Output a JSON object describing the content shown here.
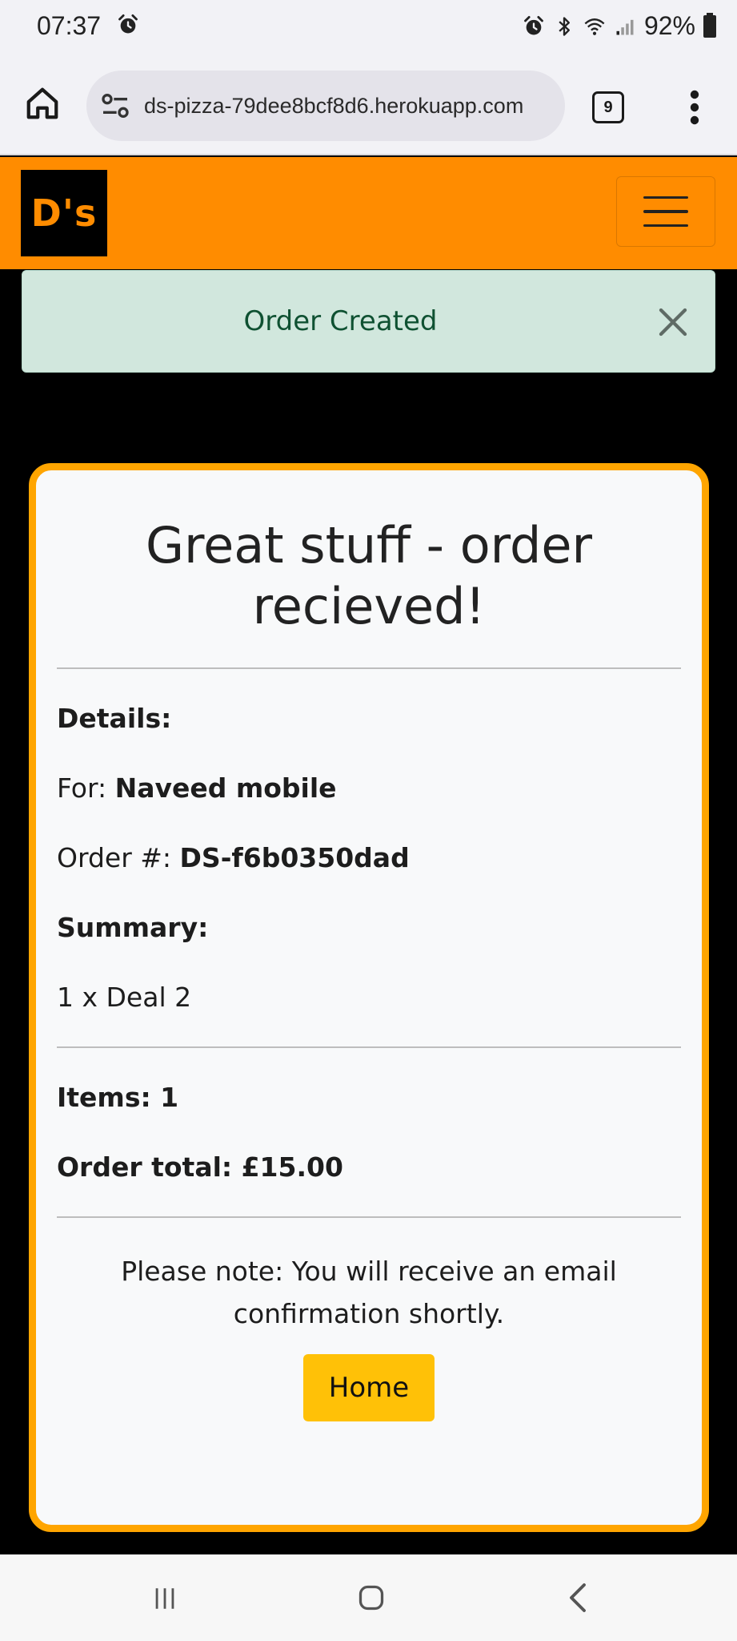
{
  "status_bar": {
    "time": "07:37",
    "battery": "92%",
    "icons": [
      "alarm-icon",
      "alarm-icon",
      "bluetooth-icon",
      "wifi-icon",
      "signal-icon",
      "battery-icon"
    ]
  },
  "browser": {
    "url": "ds-pizza-79dee8bcf8d6.herokuapp.com",
    "tab_count": "9"
  },
  "header": {
    "brand": "D's",
    "brand_color": "#ff8c00"
  },
  "alert": {
    "message": "Order Created"
  },
  "card": {
    "title": "Great stuff - order recieved!",
    "details_label": "Details:",
    "for_label": "For: ",
    "for_value": "Naveed mobile",
    "order_label": "Order #: ",
    "order_value": "DS-f6b0350dad",
    "summary_label": "Summary:",
    "summary_items": [
      "1 x Deal 2"
    ],
    "items_text": "Items: 1",
    "total_text": "Order total: £15.00",
    "note": "Please note: You will receive an email confirmation shortly.",
    "home_button": "Home"
  },
  "colors": {
    "accent": "#ffa500",
    "alert_bg": "#d1e7dd",
    "alert_text": "#0f5132",
    "button": "#ffc107"
  }
}
